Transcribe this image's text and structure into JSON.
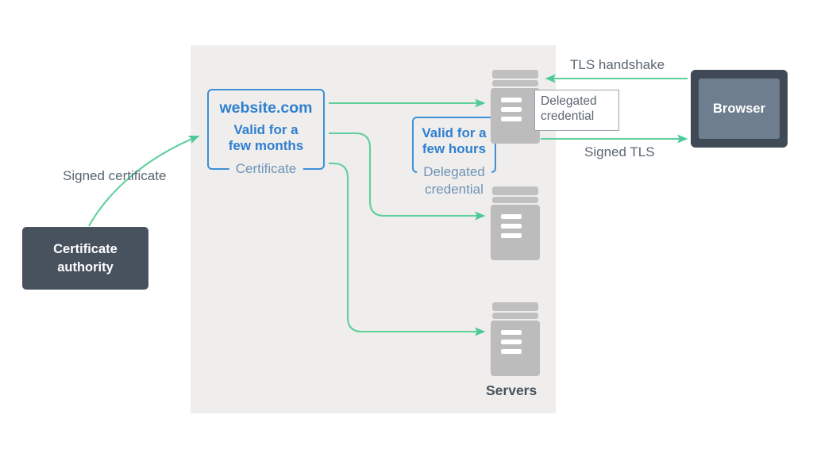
{
  "diagram": {
    "title": "Delegated credentials TLS flow",
    "colors": {
      "panel_bg": "#f0eeec",
      "arrow_green": "#5fcf9b",
      "accent_blue": "#2f7fd0",
      "box_border_blue": "#3d8fd6",
      "muted_blue": "#6f93b8",
      "dark_slate": "#47525e",
      "browser_frame": "#3f4a56",
      "browser_screen": "#6e7e8f",
      "server_grey": "#bcbcbc",
      "text_grey": "#5b6671"
    }
  },
  "certificate_authority": {
    "line1": "Certificate",
    "line2": "authority"
  },
  "website_certificate": {
    "title": "website.com",
    "sub_line1": "Valid for a",
    "sub_line2": "few months",
    "caption": "Certificate"
  },
  "delegated_certificate": {
    "sub_line1": "Valid for a",
    "sub_line2": "few hours",
    "caption": "Delegated",
    "caption_line2": "credential"
  },
  "callout": {
    "line1": "Delegated",
    "line2": "credential"
  },
  "browser": {
    "label": "Browser"
  },
  "servers": {
    "label": "Servers",
    "icons": [
      {
        "name": "server-top"
      },
      {
        "name": "server-mid"
      },
      {
        "name": "server-bottom"
      }
    ]
  },
  "labels": {
    "signed_certificate": "Signed certificate",
    "tls_handshake": "TLS handshake",
    "signed_tls": "Signed TLS"
  }
}
